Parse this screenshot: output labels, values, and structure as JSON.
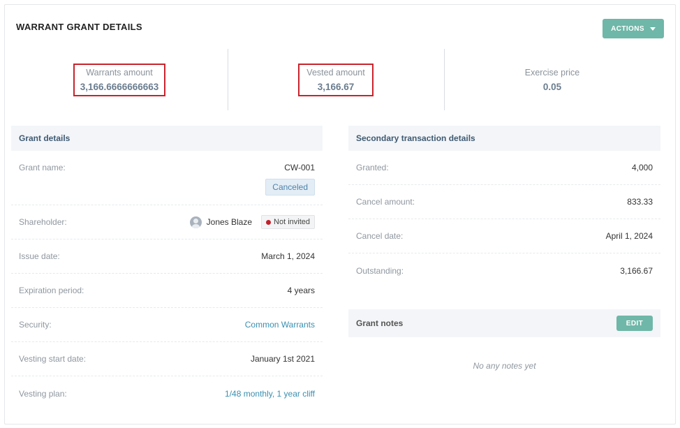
{
  "header": {
    "title": "WARRANT GRANT DETAILS",
    "actions_label": "ACTIONS"
  },
  "stats": [
    {
      "label": "Warrants amount",
      "value": "3,166.6666666663",
      "highlighted": true
    },
    {
      "label": "Vested amount",
      "value": "3,166.67",
      "highlighted": true
    },
    {
      "label": "Exercise price",
      "value": "0.05",
      "highlighted": false
    }
  ],
  "grant_details": {
    "heading": "Grant details",
    "grant_name_label": "Grant name:",
    "grant_name": "CW-001",
    "status_badge": "Canceled",
    "shareholder_label": "Shareholder:",
    "shareholder": "Jones Blaze",
    "invite_status": "Not invited",
    "issue_date_label": "Issue date:",
    "issue_date": "March 1, 2024",
    "expiration_label": "Expiration period:",
    "expiration": "4 years",
    "security_label": "Security:",
    "security": "Common Warrants",
    "vesting_start_label": "Vesting start date:",
    "vesting_start": "January 1st 2021",
    "vesting_plan_label": "Vesting plan:",
    "vesting_plan": "1/48 monthly, 1 year cliff"
  },
  "secondary": {
    "heading": "Secondary transaction details",
    "granted_label": "Granted:",
    "granted": "4,000",
    "cancel_amount_label": "Cancel amount:",
    "cancel_amount": "833.33",
    "cancel_date_label": "Cancel date:",
    "cancel_date": "April 1, 2024",
    "outstanding_label": "Outstanding:",
    "outstanding": "3,166.67"
  },
  "notes": {
    "heading": "Grant notes",
    "edit_label": "EDIT",
    "empty_text": "No any notes yet"
  },
  "colors": {
    "accent": "#6fb7a8",
    "highlight_border": "#c8232c",
    "link": "#3a8fb0",
    "status_red": "#c0202a"
  }
}
